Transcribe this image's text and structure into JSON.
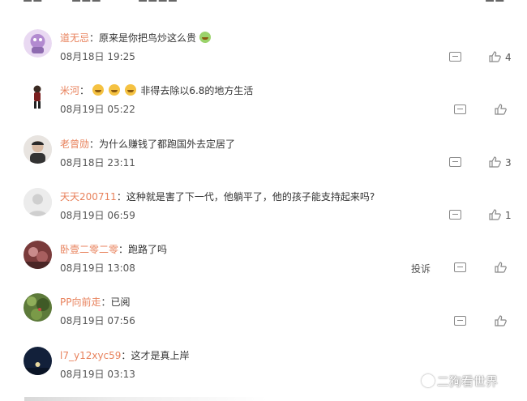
{
  "comments": [
    {
      "username": "道无忌",
      "text": "原来是你把鸟炒这么贵",
      "time": "08月18日 19:25",
      "likes": "4",
      "emoji_prefix": 0,
      "emoji_suffix": true,
      "report": ""
    },
    {
      "username": "米河",
      "text": "非得去除以6.8的地方生活",
      "time": "08月19日 05:22",
      "likes": "",
      "emoji_prefix": 3,
      "emoji_suffix": false,
      "report": ""
    },
    {
      "username": "老曾勋",
      "text": "为什么赚钱了都跑国外去定居了",
      "time": "08月18日 23:11",
      "likes": "3",
      "emoji_prefix": 0,
      "emoji_suffix": false,
      "report": ""
    },
    {
      "username": "天天200711",
      "text": "这种就是害了下一代，他躺平了，他的孩子能支持起来吗?",
      "time": "08月19日 06:59",
      "likes": "1",
      "emoji_prefix": 0,
      "emoji_suffix": false,
      "report": ""
    },
    {
      "username": "卧壹二零二零",
      "text": "跑路了吗",
      "time": "08月19日 13:08",
      "likes": "",
      "emoji_prefix": 0,
      "emoji_suffix": false,
      "report": "投诉"
    },
    {
      "username": "PP向前走",
      "text": "已阅",
      "time": "08月19日 07:56",
      "likes": "",
      "emoji_prefix": 0,
      "emoji_suffix": false,
      "report": ""
    },
    {
      "username": "l7_y12xyc59",
      "text": "这才是真上岸",
      "time": "08月19日 03:13",
      "likes": "",
      "emoji_prefix": 0,
      "emoji_suffix": false,
      "report": ""
    }
  ],
  "watermark": "二狗看世界",
  "colors": {
    "username": "#e8825c",
    "text": "#333333",
    "meta": "#555555"
  }
}
